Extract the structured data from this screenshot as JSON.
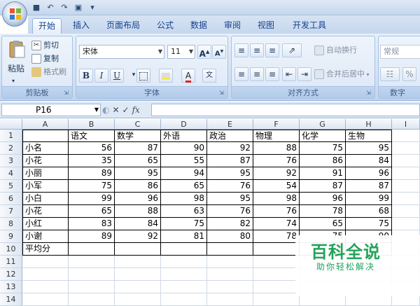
{
  "tabs": [
    "开始",
    "插入",
    "页面布局",
    "公式",
    "数据",
    "审阅",
    "视图",
    "开发工具"
  ],
  "clipboard": {
    "paste": "粘贴",
    "cut": "剪切",
    "copy": "复制",
    "format_painter": "格式刷",
    "group": "剪贴板"
  },
  "font": {
    "name": "宋体",
    "size": "11",
    "grow": "A",
    "shrink": "A",
    "bold": "B",
    "italic": "I",
    "underline": "U",
    "color_letter": "A",
    "group": "字体"
  },
  "alignment": {
    "wrap": "自动换行",
    "merge": "合并后居中",
    "group": "对齐方式"
  },
  "number": {
    "format": "常规",
    "percent": "%",
    "group": "数字"
  },
  "formula_bar": {
    "cell_ref": "P16",
    "fx": "fx",
    "content": ""
  },
  "columns": [
    "A",
    "B",
    "C",
    "D",
    "E",
    "F",
    "G",
    "H",
    "I"
  ],
  "rows": [
    "1",
    "2",
    "3",
    "4",
    "5",
    "6",
    "7",
    "8",
    "9",
    "10",
    "11",
    "12",
    "13",
    "14"
  ],
  "headers": [
    "",
    "语文",
    "数学",
    "外语",
    "政治",
    "物理",
    "化学",
    "生物"
  ],
  "table": [
    [
      "小名",
      "56",
      "87",
      "90",
      "92",
      "88",
      "75",
      "95"
    ],
    [
      "小花",
      "35",
      "65",
      "55",
      "87",
      "76",
      "86",
      "84"
    ],
    [
      "小丽",
      "89",
      "95",
      "94",
      "95",
      "92",
      "91",
      "96"
    ],
    [
      "小军",
      "75",
      "86",
      "65",
      "76",
      "54",
      "87",
      "87"
    ],
    [
      "小白",
      "99",
      "96",
      "98",
      "95",
      "98",
      "96",
      "99"
    ],
    [
      "小花",
      "65",
      "88",
      "63",
      "76",
      "76",
      "78",
      "68"
    ],
    [
      "小红",
      "83",
      "84",
      "75",
      "82",
      "74",
      "65",
      "75"
    ],
    [
      "小谢",
      "89",
      "92",
      "81",
      "80",
      "78",
      "75",
      "90"
    ]
  ],
  "average_label": "平均分",
  "watermark": {
    "title": "百科全说",
    "subtitle": "助你轻松解决"
  }
}
